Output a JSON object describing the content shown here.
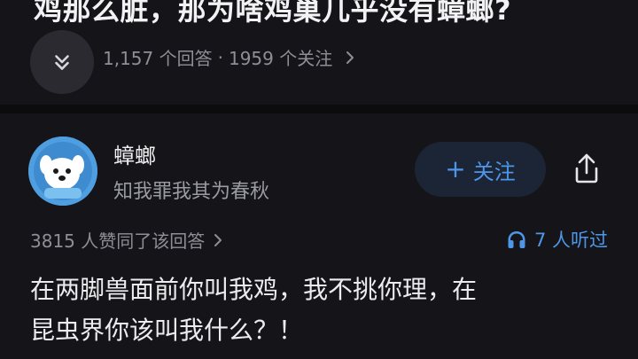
{
  "question": {
    "title": "鸡那么脏，那为啥鸡巢几乎没有蟑螂?",
    "answer_count": "1,157 个回答",
    "separator": "·",
    "follower_count": "1959 个关注"
  },
  "author": {
    "name": "蟑螂",
    "bio": "知我罪我其为春秋",
    "follow_icon": "+",
    "follow_label": "关注"
  },
  "meta": {
    "upvotes": "3815 人赞同了该回答",
    "listeners": "7 人听过"
  },
  "answer": {
    "line1": "在两脚兽面前你叫我鸡，我不挑你理，在",
    "line2": "昆虫界你该叫我什么？！"
  },
  "icons": {
    "expand": "chevron-double-down-icon",
    "share": "share-icon",
    "listen": "headphones-icon",
    "stats_more": "chevron-right-icon"
  },
  "colors": {
    "background": "#151519",
    "accent": "#4e96e8",
    "avatar": "#4f9fe0",
    "muted_text": "#8e8e96"
  }
}
